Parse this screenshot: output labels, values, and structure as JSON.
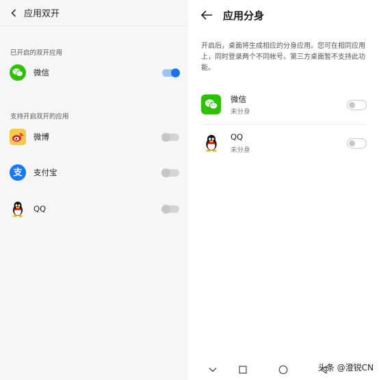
{
  "left": {
    "title": "应用双开",
    "enabled_section": "已开启的双开应用",
    "supported_section": "支持开启双开的应用",
    "enabled_apps": [
      {
        "label": "微信",
        "icon": "wechat-icon",
        "toggle": "on"
      }
    ],
    "supported_apps": [
      {
        "label": "微博",
        "icon": "weibo-icon",
        "toggle": "off"
      },
      {
        "label": "支付宝",
        "icon": "alipay-icon",
        "toggle": "off"
      },
      {
        "label": "QQ",
        "icon": "qq-icon",
        "toggle": "off"
      }
    ]
  },
  "right": {
    "title": "应用分身",
    "description": "开启后，桌面将生成相应的分身应用。您可在相同应用上，同时登录两个不同帐号。第三方桌面暂不支持此功能。",
    "apps": [
      {
        "name": "微信",
        "status": "未分身",
        "icon": "wechat-icon",
        "toggle": "off"
      },
      {
        "name": "QQ",
        "status": "未分身",
        "icon": "qq-icon",
        "toggle": "off"
      }
    ]
  },
  "nav": {
    "icons": [
      "chevron-down-icon",
      "recents-square-icon",
      "home-circle-icon",
      "back-triangle-icon"
    ]
  },
  "watermark": "头条 @澄锐CN",
  "colors": {
    "accent": "#1a73e8",
    "wechat_green": "#2dc100",
    "alipay_blue": "#1677ff",
    "weibo_red": "#e6162d"
  }
}
